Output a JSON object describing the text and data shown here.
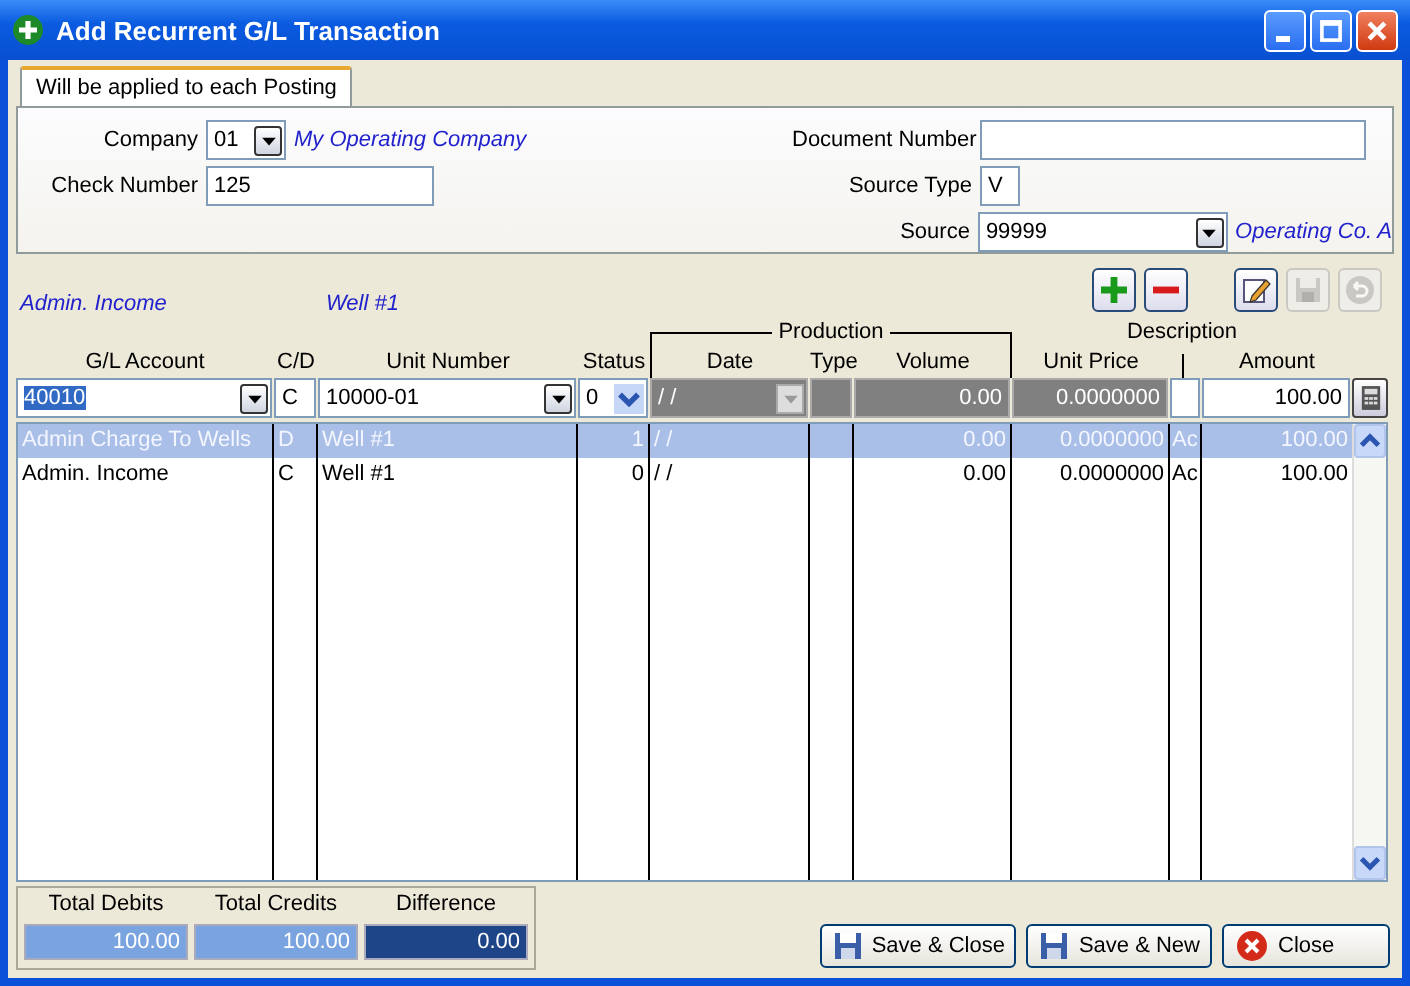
{
  "window": {
    "title": "Add Recurrent G/L Transaction"
  },
  "tab": {
    "label": "Will be applied to each Posting",
    "selected": true
  },
  "company": {
    "label": "Company",
    "value": "01",
    "name": "My Operating Company"
  },
  "check_number": {
    "label": "Check Number",
    "value": "125"
  },
  "document_number": {
    "label": "Document Number"
  },
  "source_type": {
    "label": "Source Type",
    "value": "V"
  },
  "source": {
    "label": "Source",
    "value": "99999",
    "name": "Operating Co. A"
  },
  "toolbar": [
    {
      "kind": "add",
      "disabled": false
    },
    {
      "kind": "remove",
      "disabled": false
    },
    {
      "kind": "edit",
      "disabled": false
    },
    {
      "kind": "save",
      "disabled": true
    },
    {
      "kind": "undo",
      "disabled": true
    }
  ],
  "info": {
    "account_name": "Admin. Income",
    "unit_name": "Well #1"
  },
  "grid": {
    "group_label": "Production",
    "description_label": "Description",
    "columns": [
      "G/L Account",
      "C/D",
      "Unit Number",
      "Status",
      "Date",
      "Type",
      "Volume",
      "Unit Price",
      "Amount"
    ],
    "entry": {
      "gl_account": "40010",
      "cd": "C",
      "unit_number": "10000-01",
      "status": "0",
      "date": "/ /",
      "volume": "0.00",
      "unit_price": "0.0000000",
      "amount": "100.00"
    },
    "rows": [
      {
        "selected": true,
        "cells": [
          "Admin Charge To Wells",
          "D",
          "Well #1",
          "1",
          "/ /",
          "",
          "0.00",
          "0.0000000",
          "Ac",
          "100.00"
        ]
      },
      {
        "selected": false,
        "cells": [
          "Admin. Income",
          "C",
          "Well #1",
          "0",
          "/ /",
          "",
          "0.00",
          "0.0000000",
          "Ac",
          "100.00"
        ]
      }
    ]
  },
  "totals": [
    {
      "label": "Total Debits",
      "value": "100.00",
      "kind": "light"
    },
    {
      "label": "Total Credits",
      "value": "100.00",
      "kind": "light"
    },
    {
      "label": "Difference",
      "value": "0.00",
      "kind": "dark"
    }
  ],
  "buttons": [
    {
      "label": "Save & Close",
      "kind": "save"
    },
    {
      "label": "Save & New",
      "kind": "save"
    },
    {
      "label": "Close",
      "kind": "close"
    }
  ]
}
